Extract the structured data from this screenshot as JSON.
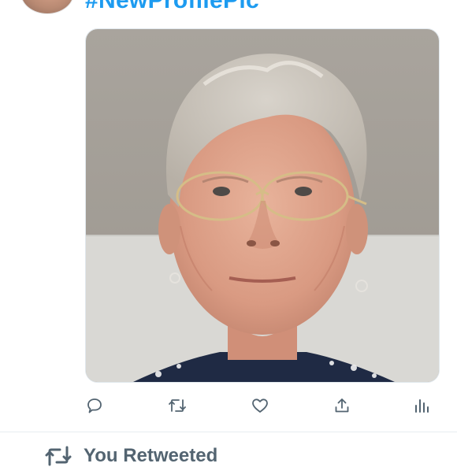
{
  "tweet": {
    "hashtag": "#NewProfilePic",
    "media": {
      "subject": "profile-photo",
      "border_color": "#e1e8ed"
    }
  },
  "actions": [
    {
      "name": "reply",
      "icon": "reply-icon"
    },
    {
      "name": "retweet",
      "icon": "retweet-icon"
    },
    {
      "name": "like",
      "icon": "heart-icon"
    },
    {
      "name": "share",
      "icon": "share-icon"
    },
    {
      "name": "analytics",
      "icon": "analytics-icon"
    }
  ],
  "next_item": {
    "context_label": "You Retweeted",
    "icon": "retweet-icon"
  },
  "colors": {
    "link": "#1d9bf0",
    "icon": "#536471",
    "divider": "#e7ecf0"
  }
}
